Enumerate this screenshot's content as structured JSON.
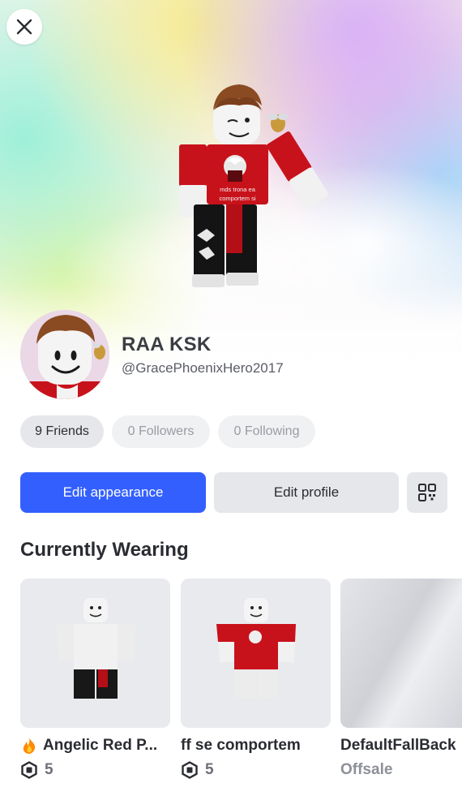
{
  "profile": {
    "display_name": "RAA KSK",
    "username": "@GracePhoenixHero2017",
    "shirt_text": "mds tronaaa comportem si"
  },
  "stats": {
    "friends": "9 Friends",
    "followers": "0 Followers",
    "following": "0 Following"
  },
  "actions": {
    "edit_appearance": "Edit appearance",
    "edit_profile": "Edit profile"
  },
  "wearing": {
    "title": "Currently Wearing",
    "items": [
      {
        "name": "Angelic Red P...",
        "price": "5",
        "badge_icon": "fire-icon"
      },
      {
        "name": "ff se comportem",
        "price": "5"
      },
      {
        "name": "DefaultFallBack",
        "price": "Offsale"
      }
    ]
  },
  "colors": {
    "accent": "#335fff",
    "pill_bg": "#e6e7ea",
    "shirt_red": "#c8121b"
  }
}
